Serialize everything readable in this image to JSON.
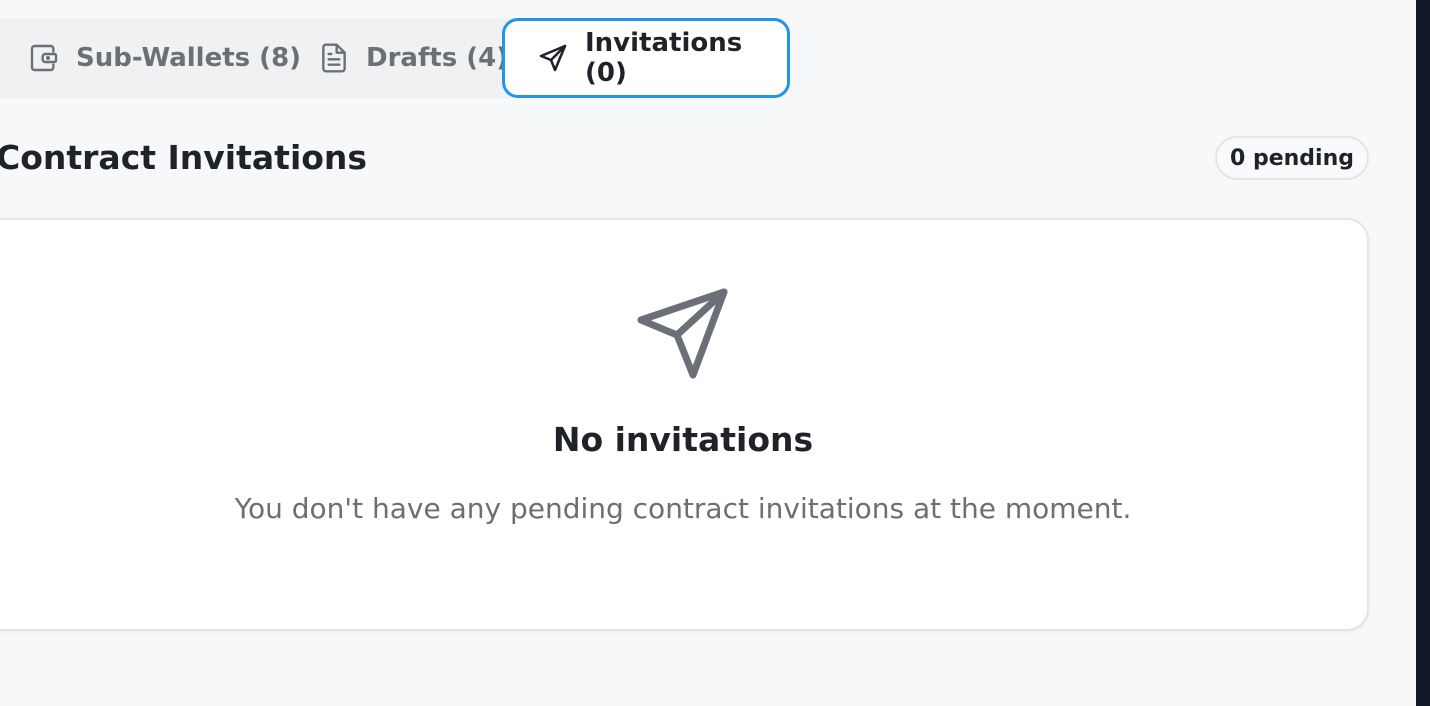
{
  "tabs": [
    {
      "label": "Sub-Wallets (8)",
      "icon": "wallet-icon"
    },
    {
      "label": "Drafts (4)",
      "icon": "document-icon"
    },
    {
      "label": "Invitations (0)",
      "icon": "send-icon",
      "active": true
    }
  ],
  "section": {
    "title": "Contract Invitations",
    "badge": "0 pending"
  },
  "empty_state": {
    "icon": "send-icon",
    "title": "No invitations",
    "description": "You don't have any pending contract invitations at the moment."
  },
  "colors": {
    "accent": "#2196e8",
    "background": "#f7f8f9",
    "muted_text": "#6b7075",
    "dark_text": "#1f2328",
    "icon_gray": "#6b6f78"
  }
}
